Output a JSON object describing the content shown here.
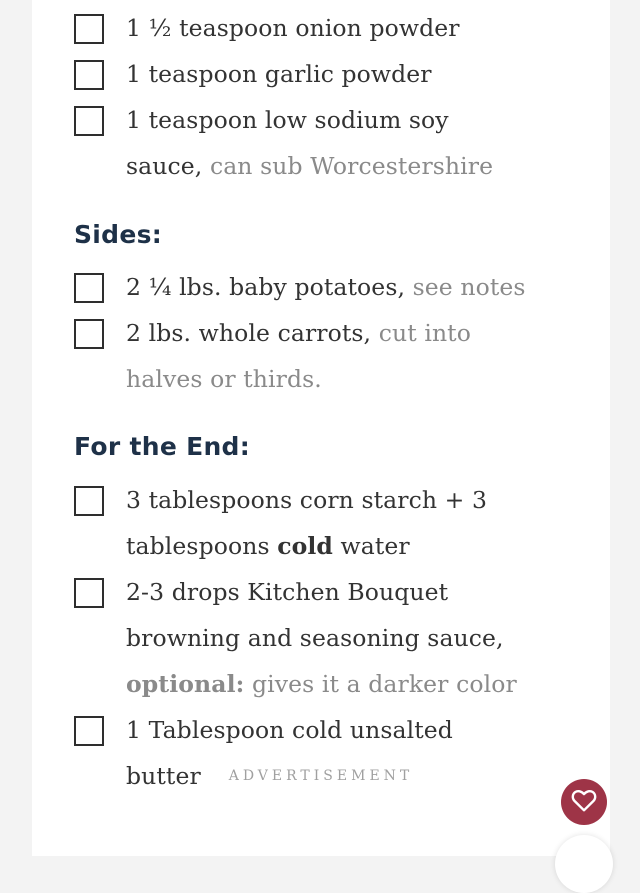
{
  "groups": [
    {
      "heading": "",
      "items": [
        {
          "text": "1 ½ teaspoon onion powder"
        },
        {
          "text": "1 teaspoon garlic powder"
        },
        {
          "text": "1 teaspoon low sodium soy sauce,",
          "note": "can sub Worcestershire"
        }
      ]
    },
    {
      "heading": "Sides:",
      "items": [
        {
          "text": "2 ¼ lbs. baby potatoes,",
          "note": "see notes"
        },
        {
          "text": "2 lbs. whole carrots,",
          "note": "cut into halves or thirds."
        }
      ]
    },
    {
      "heading": "For the End:",
      "items": [
        {
          "text_a": "3 tablespoons corn starch + 3 tablespoons ",
          "bold": "cold",
          "text_b": " water"
        },
        {
          "text": "2-3 drops Kitchen Bouquet browning and seasoning sauce,",
          "note_bold": "optional:",
          "note": "gives it a darker color"
        },
        {
          "text": "1 Tablespoon cold unsalted butter"
        }
      ]
    }
  ],
  "advertisement_label": "ADVERTISEMENT",
  "favorite_icon": "heart-icon",
  "colors": {
    "heading": "#1e3148",
    "note": "#8a8a8a",
    "favorite_button": "#9e3447"
  }
}
